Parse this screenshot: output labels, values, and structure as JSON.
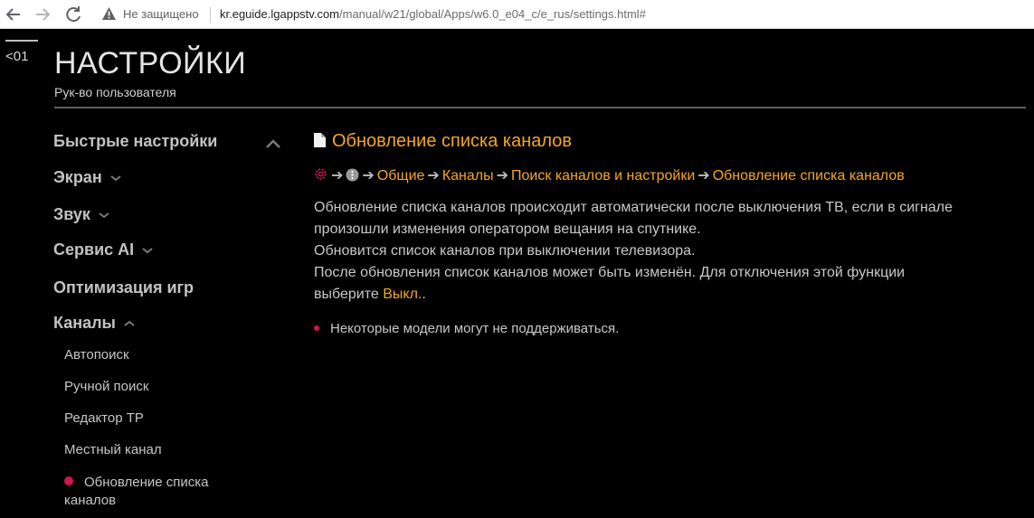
{
  "browser": {
    "not_secure_label": "Не защищено",
    "url_domain": "kr.eguide.lgappstv.com",
    "url_path": "/manual/w21/global/Apps/w6.0_e04_c/e_rus/settings.html#"
  },
  "page": {
    "nav_label": "<01",
    "title": "НАСТРОЙКИ",
    "subtitle": "Рук-во пользователя"
  },
  "sidebar": {
    "items": [
      {
        "label": "Быстрые настройки",
        "expanded": true
      },
      {
        "label": "Экран",
        "expanded": false
      },
      {
        "label": "Звук",
        "expanded": false
      },
      {
        "label": "Сервис AI",
        "expanded": false
      },
      {
        "label": "Оптимизация игр"
      },
      {
        "label": "Каналы",
        "expanded": true
      }
    ],
    "subitems": [
      {
        "label": "Автопоиск"
      },
      {
        "label": "Ручной поиск"
      },
      {
        "label": "Редактор TP"
      },
      {
        "label": "Местный канал"
      }
    ],
    "active_item": {
      "label": "Обновление списка каналов"
    }
  },
  "content": {
    "title": "Обновление списка каналов",
    "breadcrumb": {
      "icons": [
        "gear-icon",
        "dots-menu-icon"
      ],
      "links": [
        "Общие",
        "Каналы",
        "Поиск каналов и настройки",
        "Обновление списка каналов"
      ]
    },
    "paragraph_1": "Обновление списка каналов происходит автоматически после выключения ТВ, если в сигнале произошли изменения оператором вещания на спутнике.",
    "paragraph_2": "Обновится список каналов при выключении телевизора.",
    "paragraph_3_pre": "После обновления список каналов может быть изменён. Для отключения этой функции выберите ",
    "paragraph_3_highlight": "Выкл.",
    "paragraph_3_post": ".",
    "note": "Некоторые модели могут не поддерживаться."
  },
  "colors": {
    "accent": "#f5a623",
    "bullet": "#d2154a",
    "background": "#000000"
  }
}
